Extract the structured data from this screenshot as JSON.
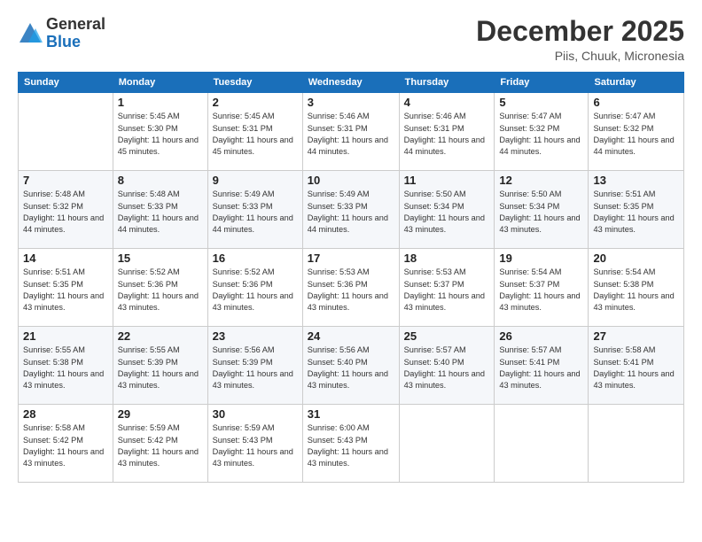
{
  "header": {
    "logo_line1": "General",
    "logo_line2": "Blue",
    "month": "December 2025",
    "location": "Piis, Chuuk, Micronesia"
  },
  "days_of_week": [
    "Sunday",
    "Monday",
    "Tuesday",
    "Wednesday",
    "Thursday",
    "Friday",
    "Saturday"
  ],
  "weeks": [
    [
      {
        "day": "",
        "info": ""
      },
      {
        "day": "1",
        "info": "Sunrise: 5:45 AM\nSunset: 5:30 PM\nDaylight: 11 hours\nand 45 minutes."
      },
      {
        "day": "2",
        "info": "Sunrise: 5:45 AM\nSunset: 5:31 PM\nDaylight: 11 hours\nand 45 minutes."
      },
      {
        "day": "3",
        "info": "Sunrise: 5:46 AM\nSunset: 5:31 PM\nDaylight: 11 hours\nand 44 minutes."
      },
      {
        "day": "4",
        "info": "Sunrise: 5:46 AM\nSunset: 5:31 PM\nDaylight: 11 hours\nand 44 minutes."
      },
      {
        "day": "5",
        "info": "Sunrise: 5:47 AM\nSunset: 5:32 PM\nDaylight: 11 hours\nand 44 minutes."
      },
      {
        "day": "6",
        "info": "Sunrise: 5:47 AM\nSunset: 5:32 PM\nDaylight: 11 hours\nand 44 minutes."
      }
    ],
    [
      {
        "day": "7",
        "info": "Sunrise: 5:48 AM\nSunset: 5:32 PM\nDaylight: 11 hours\nand 44 minutes."
      },
      {
        "day": "8",
        "info": "Sunrise: 5:48 AM\nSunset: 5:33 PM\nDaylight: 11 hours\nand 44 minutes."
      },
      {
        "day": "9",
        "info": "Sunrise: 5:49 AM\nSunset: 5:33 PM\nDaylight: 11 hours\nand 44 minutes."
      },
      {
        "day": "10",
        "info": "Sunrise: 5:49 AM\nSunset: 5:33 PM\nDaylight: 11 hours\nand 44 minutes."
      },
      {
        "day": "11",
        "info": "Sunrise: 5:50 AM\nSunset: 5:34 PM\nDaylight: 11 hours\nand 43 minutes."
      },
      {
        "day": "12",
        "info": "Sunrise: 5:50 AM\nSunset: 5:34 PM\nDaylight: 11 hours\nand 43 minutes."
      },
      {
        "day": "13",
        "info": "Sunrise: 5:51 AM\nSunset: 5:35 PM\nDaylight: 11 hours\nand 43 minutes."
      }
    ],
    [
      {
        "day": "14",
        "info": "Sunrise: 5:51 AM\nSunset: 5:35 PM\nDaylight: 11 hours\nand 43 minutes."
      },
      {
        "day": "15",
        "info": "Sunrise: 5:52 AM\nSunset: 5:36 PM\nDaylight: 11 hours\nand 43 minutes."
      },
      {
        "day": "16",
        "info": "Sunrise: 5:52 AM\nSunset: 5:36 PM\nDaylight: 11 hours\nand 43 minutes."
      },
      {
        "day": "17",
        "info": "Sunrise: 5:53 AM\nSunset: 5:36 PM\nDaylight: 11 hours\nand 43 minutes."
      },
      {
        "day": "18",
        "info": "Sunrise: 5:53 AM\nSunset: 5:37 PM\nDaylight: 11 hours\nand 43 minutes."
      },
      {
        "day": "19",
        "info": "Sunrise: 5:54 AM\nSunset: 5:37 PM\nDaylight: 11 hours\nand 43 minutes."
      },
      {
        "day": "20",
        "info": "Sunrise: 5:54 AM\nSunset: 5:38 PM\nDaylight: 11 hours\nand 43 minutes."
      }
    ],
    [
      {
        "day": "21",
        "info": "Sunrise: 5:55 AM\nSunset: 5:38 PM\nDaylight: 11 hours\nand 43 minutes."
      },
      {
        "day": "22",
        "info": "Sunrise: 5:55 AM\nSunset: 5:39 PM\nDaylight: 11 hours\nand 43 minutes."
      },
      {
        "day": "23",
        "info": "Sunrise: 5:56 AM\nSunset: 5:39 PM\nDaylight: 11 hours\nand 43 minutes."
      },
      {
        "day": "24",
        "info": "Sunrise: 5:56 AM\nSunset: 5:40 PM\nDaylight: 11 hours\nand 43 minutes."
      },
      {
        "day": "25",
        "info": "Sunrise: 5:57 AM\nSunset: 5:40 PM\nDaylight: 11 hours\nand 43 minutes."
      },
      {
        "day": "26",
        "info": "Sunrise: 5:57 AM\nSunset: 5:41 PM\nDaylight: 11 hours\nand 43 minutes."
      },
      {
        "day": "27",
        "info": "Sunrise: 5:58 AM\nSunset: 5:41 PM\nDaylight: 11 hours\nand 43 minutes."
      }
    ],
    [
      {
        "day": "28",
        "info": "Sunrise: 5:58 AM\nSunset: 5:42 PM\nDaylight: 11 hours\nand 43 minutes."
      },
      {
        "day": "29",
        "info": "Sunrise: 5:59 AM\nSunset: 5:42 PM\nDaylight: 11 hours\nand 43 minutes."
      },
      {
        "day": "30",
        "info": "Sunrise: 5:59 AM\nSunset: 5:43 PM\nDaylight: 11 hours\nand 43 minutes."
      },
      {
        "day": "31",
        "info": "Sunrise: 6:00 AM\nSunset: 5:43 PM\nDaylight: 11 hours\nand 43 minutes."
      },
      {
        "day": "",
        "info": ""
      },
      {
        "day": "",
        "info": ""
      },
      {
        "day": "",
        "info": ""
      }
    ]
  ]
}
